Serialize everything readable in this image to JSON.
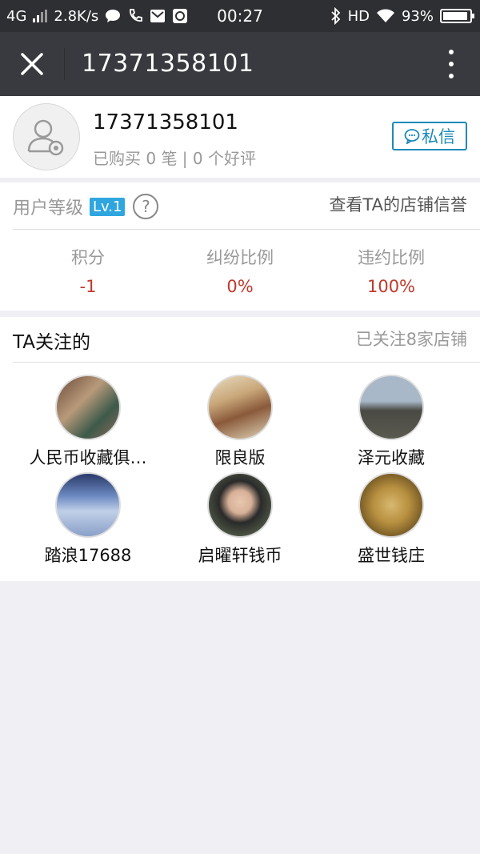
{
  "status": {
    "network": "4G",
    "speed": "2.8K/s",
    "time": "00:27",
    "hd": "HD",
    "battery": "93%",
    "battery_level": 0.93
  },
  "nav": {
    "title": "17371358101",
    "close_icon": "close-icon",
    "more_icon": "more-vertical-icon"
  },
  "profile": {
    "name": "17371358101",
    "summary": "已购买 0 笔 | 0 个好评",
    "message_button": "私信"
  },
  "level": {
    "label": "用户等级",
    "badge": "Lv.1",
    "help": "?",
    "link": "查看TA的店铺信誉",
    "stats": [
      {
        "label": "积分",
        "value": "-1"
      },
      {
        "label": "纠纷比例",
        "value": "0%"
      },
      {
        "label": "违约比例",
        "value": "100%"
      }
    ]
  },
  "follow": {
    "title": "TA关注的",
    "count": "已关注8家店铺",
    "shops": [
      {
        "name": "人民币收藏俱…"
      },
      {
        "name": "限良版"
      },
      {
        "name": "泽元收藏"
      },
      {
        "name": "踏浪17688"
      },
      {
        "name": "启曜轩钱币"
      },
      {
        "name": "盛世钱庄"
      }
    ]
  }
}
